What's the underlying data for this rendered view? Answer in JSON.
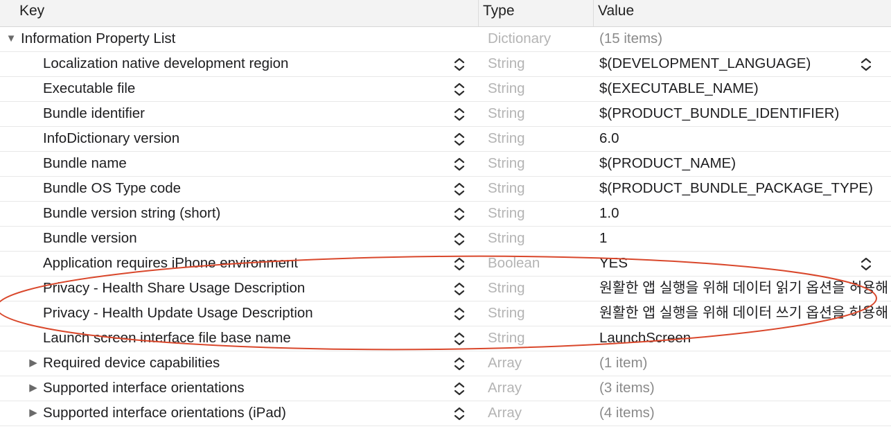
{
  "columns": {
    "key": "Key",
    "type": "Type",
    "value": "Value"
  },
  "rows": [
    {
      "key": "Information Property List",
      "type": "Dictionary",
      "value": "(15 items)"
    },
    {
      "key": "Localization native development region",
      "type": "String",
      "value": "$(DEVELOPMENT_LANGUAGE)"
    },
    {
      "key": "Executable file",
      "type": "String",
      "value": "$(EXECUTABLE_NAME)"
    },
    {
      "key": "Bundle identifier",
      "type": "String",
      "value": "$(PRODUCT_BUNDLE_IDENTIFIER)"
    },
    {
      "key": "InfoDictionary version",
      "type": "String",
      "value": "6.0"
    },
    {
      "key": "Bundle name",
      "type": "String",
      "value": "$(PRODUCT_NAME)"
    },
    {
      "key": "Bundle OS Type code",
      "type": "String",
      "value": "$(PRODUCT_BUNDLE_PACKAGE_TYPE)"
    },
    {
      "key": "Bundle version string (short)",
      "type": "String",
      "value": "1.0"
    },
    {
      "key": "Bundle version",
      "type": "String",
      "value": "1"
    },
    {
      "key": "Application requires iPhone environment",
      "type": "Boolean",
      "value": "YES"
    },
    {
      "key": "Privacy - Health Share Usage Description",
      "type": "String",
      "value": "원활한 앱 실행을 위해 데이터 읽기 옵션을 허용해"
    },
    {
      "key": "Privacy - Health Update Usage Description",
      "type": "String",
      "value": "원활한 앱 실행을 위해 데이터 쓰기 옵션을 허용해"
    },
    {
      "key": "Launch screen interface file base name",
      "type": "String",
      "value": "LaunchScreen"
    },
    {
      "key": "Required device capabilities",
      "type": "Array",
      "value": "(1 item)"
    },
    {
      "key": "Supported interface orientations",
      "type": "Array",
      "value": "(3 items)"
    },
    {
      "key": "Supported interface orientations (iPad)",
      "type": "Array",
      "value": "(4 items)"
    }
  ],
  "colors": {
    "annotation_ellipse": "#d9472b",
    "type_text": "#b4b4b4"
  },
  "icons": {
    "expanded": "disclosure-triangle-down-icon",
    "collapsed": "disclosure-triangle-right-icon",
    "stepper": "up-down-stepper-icon"
  }
}
